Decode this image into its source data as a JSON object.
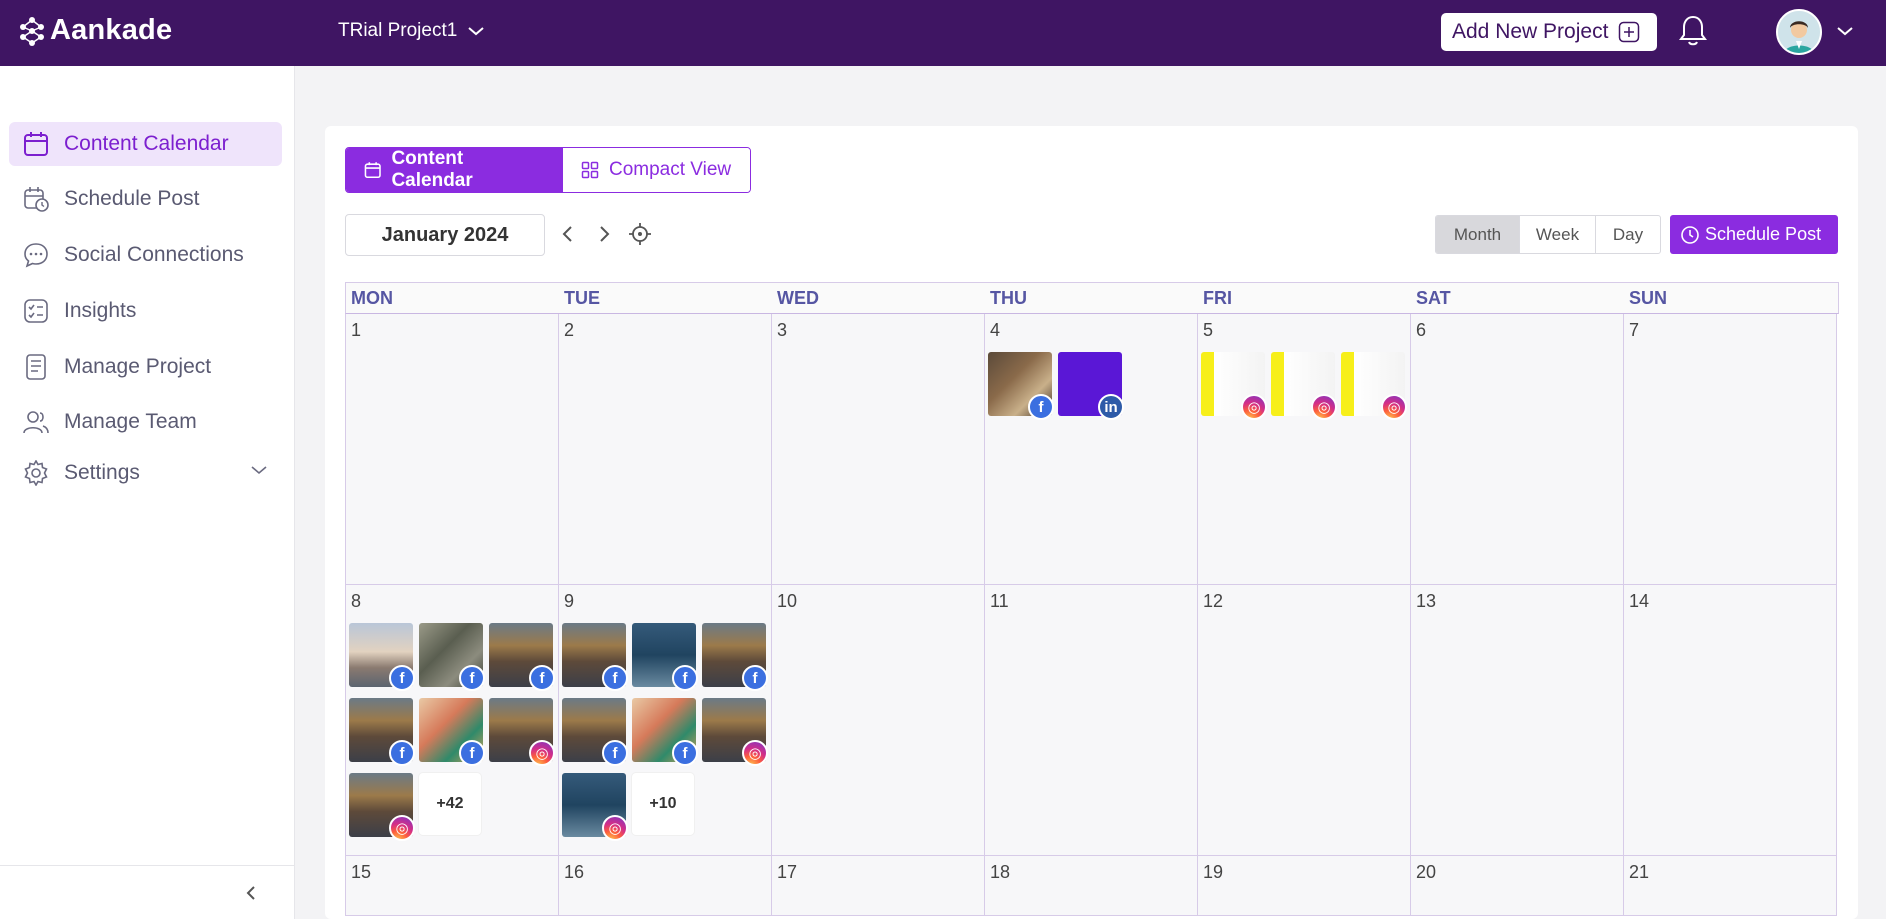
{
  "app": {
    "brand": "Aankade"
  },
  "header": {
    "project_name": "TRial Project1",
    "add_project_label": "Add New Project"
  },
  "sidebar": {
    "items": [
      {
        "label": "Content Calendar",
        "icon": "calendar-icon",
        "active": true
      },
      {
        "label": "Schedule Post",
        "icon": "calendar-clock-icon"
      },
      {
        "label": "Social Connections",
        "icon": "chat-bubble-icon"
      },
      {
        "label": "Insights",
        "icon": "checklist-icon"
      },
      {
        "label": "Manage Project",
        "icon": "document-icon"
      },
      {
        "label": "Manage Team",
        "icon": "users-icon"
      },
      {
        "label": "Settings",
        "icon": "gear-icon"
      }
    ]
  },
  "toolbar": {
    "views": [
      {
        "label": "Content Calendar",
        "selected": true
      },
      {
        "label": "Compact View",
        "selected": false
      }
    ],
    "current_month": "January 2024",
    "ranges": [
      "Month",
      "Week",
      "Day"
    ],
    "selected_range": "Month",
    "schedule_label": "Schedule Post"
  },
  "calendar": {
    "weekdays": [
      "MON",
      "TUE",
      "WED",
      "THU",
      "FRI",
      "SAT",
      "SUN"
    ],
    "weeks": [
      [
        {
          "day": "1",
          "posts": []
        },
        {
          "day": "2",
          "posts": []
        },
        {
          "day": "3",
          "posts": []
        },
        {
          "day": "4",
          "posts": [
            {
              "image": "bug",
              "platform": "facebook"
            },
            {
              "image": "brand",
              "platform": "linkedin"
            }
          ]
        },
        {
          "day": "5",
          "posts": [
            {
              "image": "hello",
              "platform": "instagram"
            },
            {
              "image": "hello",
              "platform": "instagram"
            },
            {
              "image": "hello",
              "platform": "instagram"
            }
          ]
        },
        {
          "day": "6",
          "posts": []
        },
        {
          "day": "7",
          "posts": []
        }
      ],
      [
        {
          "day": "8",
          "posts": [
            {
              "image": "bridge",
              "platform": "facebook"
            },
            {
              "image": "leaves",
              "platform": "facebook"
            },
            {
              "image": "city",
              "platform": "facebook"
            },
            {
              "image": "city",
              "platform": "facebook"
            },
            {
              "image": "girl",
              "platform": "facebook"
            },
            {
              "image": "city",
              "platform": "instagram"
            },
            {
              "image": "city",
              "platform": "instagram"
            }
          ],
          "more": "+42"
        },
        {
          "day": "9",
          "posts": [
            {
              "image": "city",
              "platform": "facebook"
            },
            {
              "image": "sea",
              "platform": "facebook"
            },
            {
              "image": "city",
              "platform": "facebook"
            },
            {
              "image": "city",
              "platform": "facebook"
            },
            {
              "image": "girl",
              "platform": "facebook"
            },
            {
              "image": "city",
              "platform": "instagram"
            },
            {
              "image": "sea",
              "platform": "instagram"
            }
          ],
          "more": "+10"
        },
        {
          "day": "10",
          "posts": []
        },
        {
          "day": "11",
          "posts": []
        },
        {
          "day": "12",
          "posts": []
        },
        {
          "day": "13",
          "posts": []
        },
        {
          "day": "14",
          "posts": []
        }
      ],
      [
        {
          "day": "15",
          "posts": []
        },
        {
          "day": "16",
          "posts": []
        },
        {
          "day": "17",
          "posts": []
        },
        {
          "day": "18",
          "posts": []
        },
        {
          "day": "19",
          "posts": []
        },
        {
          "day": "20",
          "posts": []
        },
        {
          "day": "21",
          "posts": []
        }
      ]
    ]
  },
  "colors": {
    "header_bg": "#3f1563",
    "accent": "#8b2ce0",
    "active_nav_bg": "#efe4fb"
  }
}
